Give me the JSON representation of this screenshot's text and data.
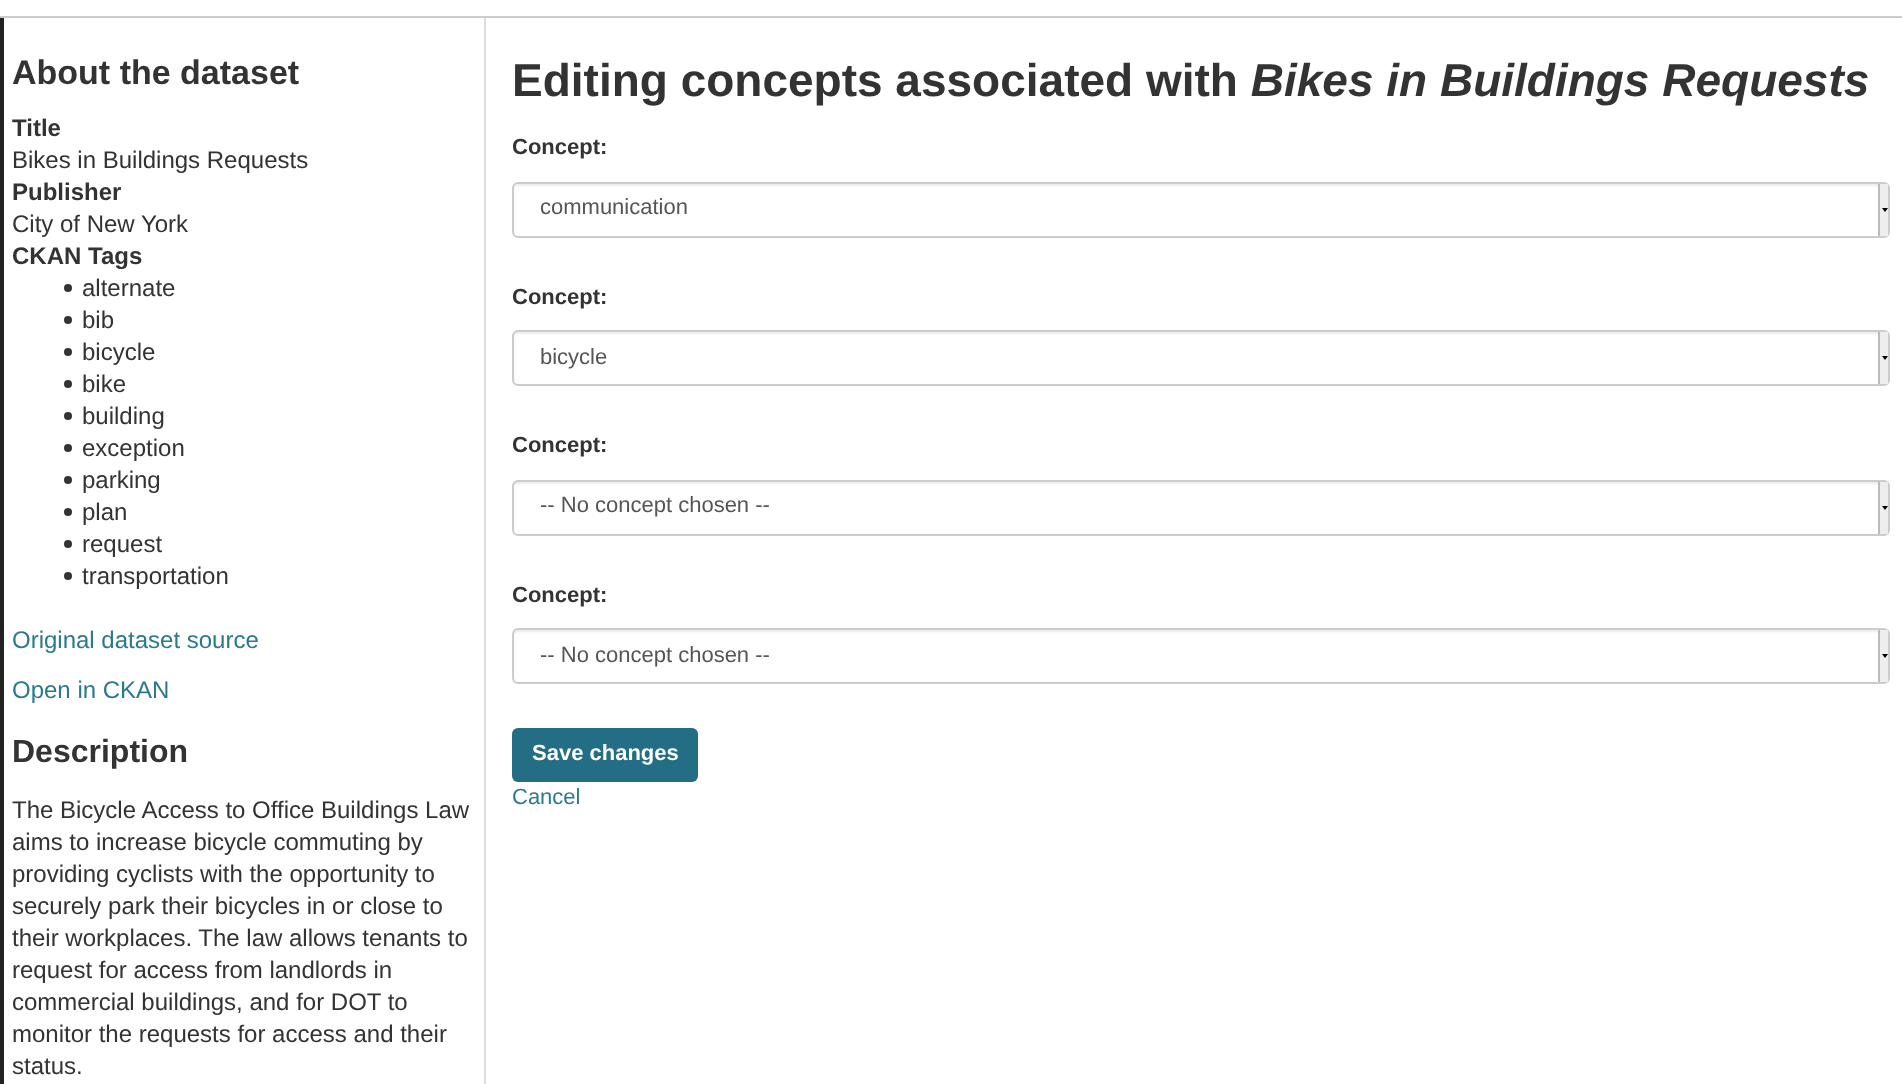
{
  "sidebar": {
    "title": "About the dataset",
    "fields": [
      {
        "label": "Title",
        "value": "Bikes in Buildings Requests"
      },
      {
        "label": "Publisher",
        "value": "City of New York"
      }
    ],
    "tags_label": "CKAN Tags",
    "tags": [
      "alternate",
      "bib",
      "bicycle",
      "bike",
      "building",
      "exception",
      "parking",
      "plan",
      "request",
      "transportation"
    ],
    "links": [
      "Original dataset source",
      "Open in CKAN"
    ],
    "description_title": "Description",
    "description": "The Bicycle Access to Office Buildings Law aims to increase bicycle commuting by providing cyclists with the opportunity to securely park their bicycles in or close to their workplaces. The law allows tenants to request for access from landlords in commercial buildings, and for DOT to monitor the requests for access and their status."
  },
  "main": {
    "heading": "Editing concepts associated with *Bikes in Buildings Requests*",
    "concepts": [
      {
        "label": "Concept:",
        "value": "communication"
      },
      {
        "label": "Concept:",
        "value": "bicycle"
      },
      {
        "label": "Concept:",
        "value": "-- No concept chosen --"
      },
      {
        "label": "Concept:",
        "value": "-- No concept chosen --"
      }
    ],
    "save_button": "Save changes",
    "cancel_link": "Cancel"
  }
}
